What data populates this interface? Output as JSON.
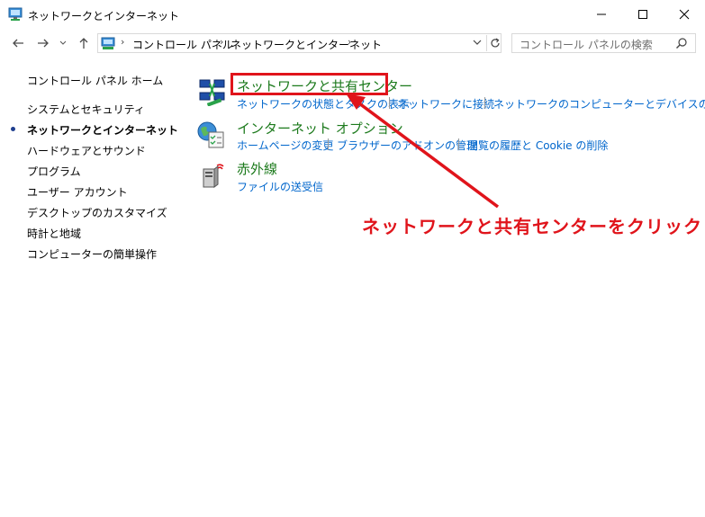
{
  "window": {
    "title": "ネットワークとインターネット",
    "controls": {
      "minimize": "minimize",
      "maximize": "maximize",
      "close": "close"
    }
  },
  "address": {
    "crumbs": [
      "コントロール パネル",
      "ネットワークとインターネット"
    ]
  },
  "search": {
    "placeholder": "コントロール パネルの検索"
  },
  "sidebar": {
    "home": "コントロール パネル ホーム",
    "items": [
      "システムとセキュリティ",
      "ネットワークとインターネット",
      "ハードウェアとサウンド",
      "プログラム",
      "ユーザー アカウント",
      "デスクトップのカスタマイズ",
      "時計と地域",
      "コンピューターの簡単操作"
    ]
  },
  "categories": [
    {
      "title": "ネットワークと共有センター",
      "tasks": [
        "ネットワークの状態とタスクの表示",
        "ネットワークに接続",
        "ネットワークのコンピューターとデバイスの表示"
      ]
    },
    {
      "title": "インターネット オプション",
      "tasks": [
        "ホームページの変更",
        "ブラウザーのアドオンの管理",
        "閲覧の履歴と Cookie の削除"
      ]
    },
    {
      "title": "赤外線",
      "tasks": [
        "ファイルの送受信"
      ]
    }
  ],
  "annotation": {
    "text": "ネットワークと共有センターをクリック"
  },
  "colors": {
    "accent_link": "#0066cc",
    "category_green": "#1c7a1c",
    "annotation_red": "#e0141b"
  }
}
